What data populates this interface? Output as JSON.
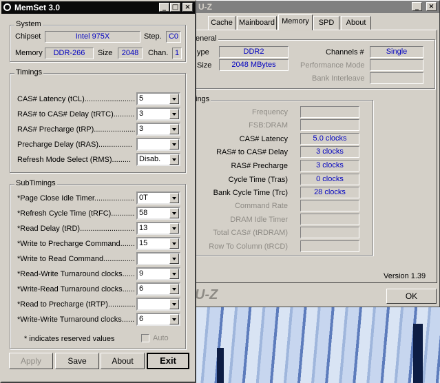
{
  "memset": {
    "title": "MemSet 3.0",
    "system": {
      "group_label": "System",
      "chipset_label": "Chipset",
      "chipset_value": "Intel 975X",
      "step_label": "Step.",
      "step_value": "C0",
      "memory_label": "Memory",
      "memory_value": "DDR-266",
      "size_label": "Size",
      "size_value": "2048",
      "chan_label": "Chan.",
      "chan_value": "1"
    },
    "timings": {
      "group_label": "Timings",
      "rows": [
        {
          "label": "CAS# Latency (tCL)..........................",
          "value": "5"
        },
        {
          "label": "RAS# to CAS# Delay (tRTC)............",
          "value": "3"
        },
        {
          "label": "RAS# Precharge (tRP)....................",
          "value": "3"
        },
        {
          "label": "Precharge Delay  (tRAS)................",
          "value": ""
        },
        {
          "label": "Refresh Mode Select (RMS).........",
          "value": "Disab."
        }
      ]
    },
    "subtimings": {
      "group_label": "SubTimings",
      "rows": [
        {
          "label": "*Page Close Idle Timer.....................",
          "value": "0T"
        },
        {
          "label": "*Refresh Cycle Time (tRFC)............",
          "value": "58"
        },
        {
          "label": "*Read Delay (tRD)...........................",
          "value": "13"
        },
        {
          "label": "*Write to Precharge Command.........",
          "value": "15"
        },
        {
          "label": "*Write to Read Command................",
          "value": ""
        },
        {
          "label": "*Read-Write Turnaround clocks.......",
          "value": "9"
        },
        {
          "label": "*Write-Read Turnaround clocks.......",
          "value": "6"
        },
        {
          "label": "*Read to Precharge (tRTP)...............",
          "value": ""
        },
        {
          "label": "*Write-Write Turnaround clocks......",
          "value": "6"
        }
      ],
      "note": "* indicates reserved values",
      "auto_label": "Auto"
    },
    "buttons": {
      "apply": "Apply",
      "save": "Save",
      "about": "About",
      "exit": "Exit"
    }
  },
  "cpuz": {
    "title_fragment": "U-Z",
    "tabs": [
      {
        "label": "Cache"
      },
      {
        "label": "Mainboard"
      },
      {
        "label": "Memory"
      },
      {
        "label": "SPD"
      },
      {
        "label": "About"
      }
    ],
    "selected_tab": "Memory",
    "general": {
      "group_label": "eneral",
      "type_label": "ype",
      "type_value": "DDR2",
      "size_label": "Size",
      "size_value": "2048 MBytes",
      "channels_label": "Channels #",
      "channels_value": "Single",
      "perf_mode_label": "Performance Mode",
      "bank_interleave_label": "Bank Interleave"
    },
    "timings": {
      "group_label": "ings",
      "rows": [
        {
          "label": "Frequency",
          "value": "",
          "enabled": false
        },
        {
          "label": "FSB:DRAM",
          "value": "",
          "enabled": false
        },
        {
          "label": "CAS# Latency",
          "value": "5.0 clocks",
          "enabled": true
        },
        {
          "label": "RAS# to CAS# Delay",
          "value": "3 clocks",
          "enabled": true
        },
        {
          "label": "RAS# Precharge",
          "value": "3 clocks",
          "enabled": true
        },
        {
          "label": "Cycle Time (Tras)",
          "value": "0 clocks",
          "enabled": true
        },
        {
          "label": "Bank Cycle Time (Trc)",
          "value": "28 clocks",
          "enabled": true
        },
        {
          "label": "Command Rate",
          "value": "",
          "enabled": false
        },
        {
          "label": "DRAM Idle Timer",
          "value": "",
          "enabled": false
        },
        {
          "label": "Total CAS# (tRDRAM)",
          "value": "",
          "enabled": false
        },
        {
          "label": "Row To Column (tRCD)",
          "value": "",
          "enabled": false
        }
      ]
    },
    "version": "Version 1.39",
    "watermark": "U-Z",
    "ok_label": "OK"
  }
}
